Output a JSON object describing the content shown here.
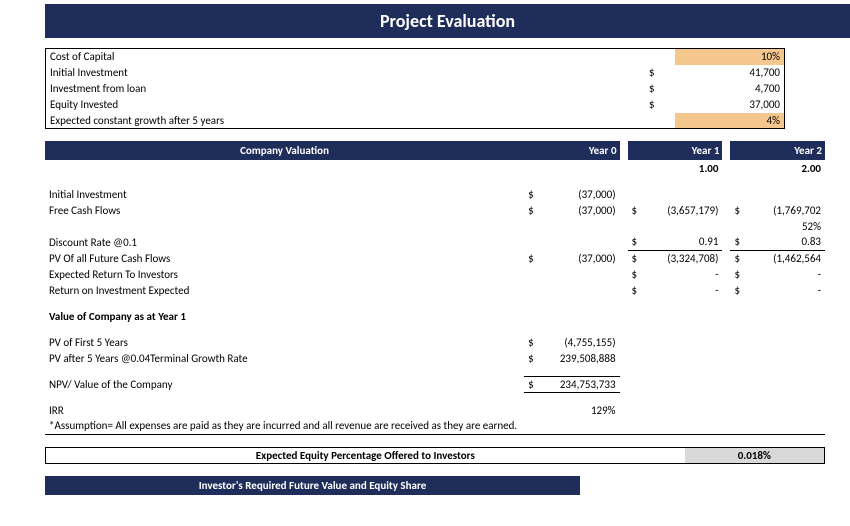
{
  "title": "Project Evaluation",
  "info": {
    "cost_of_capital_label": "Cost of Capital",
    "cost_of_capital": "10%",
    "initial_investment_label": "Initial Investment",
    "initial_investment_cur": "$",
    "initial_investment": "41,700",
    "investment_from_loan_label": "Investment from loan",
    "investment_from_loan_cur": "$",
    "investment_from_loan": "4,700",
    "equity_invested_label": "Equity Invested",
    "equity_invested_cur": "$",
    "equity_invested": "37,000",
    "growth_label": "Expected constant growth after 5 years",
    "growth": "4%"
  },
  "valuation": {
    "header": "Company Valuation",
    "years": {
      "y0": "Year 0",
      "y1": "Year 1",
      "y2": "Year 2"
    },
    "year_nums": {
      "y1": "1.00",
      "y2": "2.00"
    },
    "rows": {
      "initial_investment": {
        "label": "Initial Investment",
        "c0": "$",
        "v0": "(37,000)"
      },
      "free_cash_flows": {
        "label": "Free Cash Flows",
        "c0": "$",
        "v0": "(37,000)",
        "c1": "$",
        "v1": "(3,657,179)",
        "c2": "$",
        "v2": "(1,769,702"
      },
      "pct_row": {
        "v2": "52%"
      },
      "discount_rate": {
        "label": "Discount Rate @0.1",
        "c1": "$",
        "v1": "0.91",
        "c2": "$",
        "v2": "0.83"
      },
      "pv_future": {
        "label": "PV Of all Future Cash Flows",
        "c0": "$",
        "v0": "(37,000)",
        "c1": "$",
        "v1": "(3,324,708)",
        "c2": "$",
        "v2": "(1,462,564"
      },
      "return_inv": {
        "label": "Expected Return To Investors",
        "c1": "$",
        "v1": "-",
        "c2": "$",
        "v2": "-"
      },
      "roi": {
        "label": "Return on Investment Expected",
        "c1": "$",
        "v1": "-",
        "c2": "$",
        "v2": "-"
      },
      "value_header": "Value of Company as at Year 1",
      "pv5": {
        "label": "PV of First 5 Years",
        "c0": "$",
        "v0": "(4,755,155)"
      },
      "pv_after5": {
        "label": "PV after 5 Years @0.04Terminal Growth Rate",
        "c0": "$",
        "v0": "239,508,888"
      },
      "npv": {
        "label": "NPV/ Value of the Company",
        "c0": "$",
        "v0": "234,753,733"
      },
      "irr": {
        "label": "IRR",
        "v0": "129%"
      },
      "assumption": "*Assumption= All expenses are paid as they are incurred and all revenue are received as they are earned."
    }
  },
  "equity": {
    "label": "Expected Equity Percentage Offered to Investors",
    "value": "0.018%"
  },
  "footer_header": "Investor's Required Future Value and Equity Share"
}
